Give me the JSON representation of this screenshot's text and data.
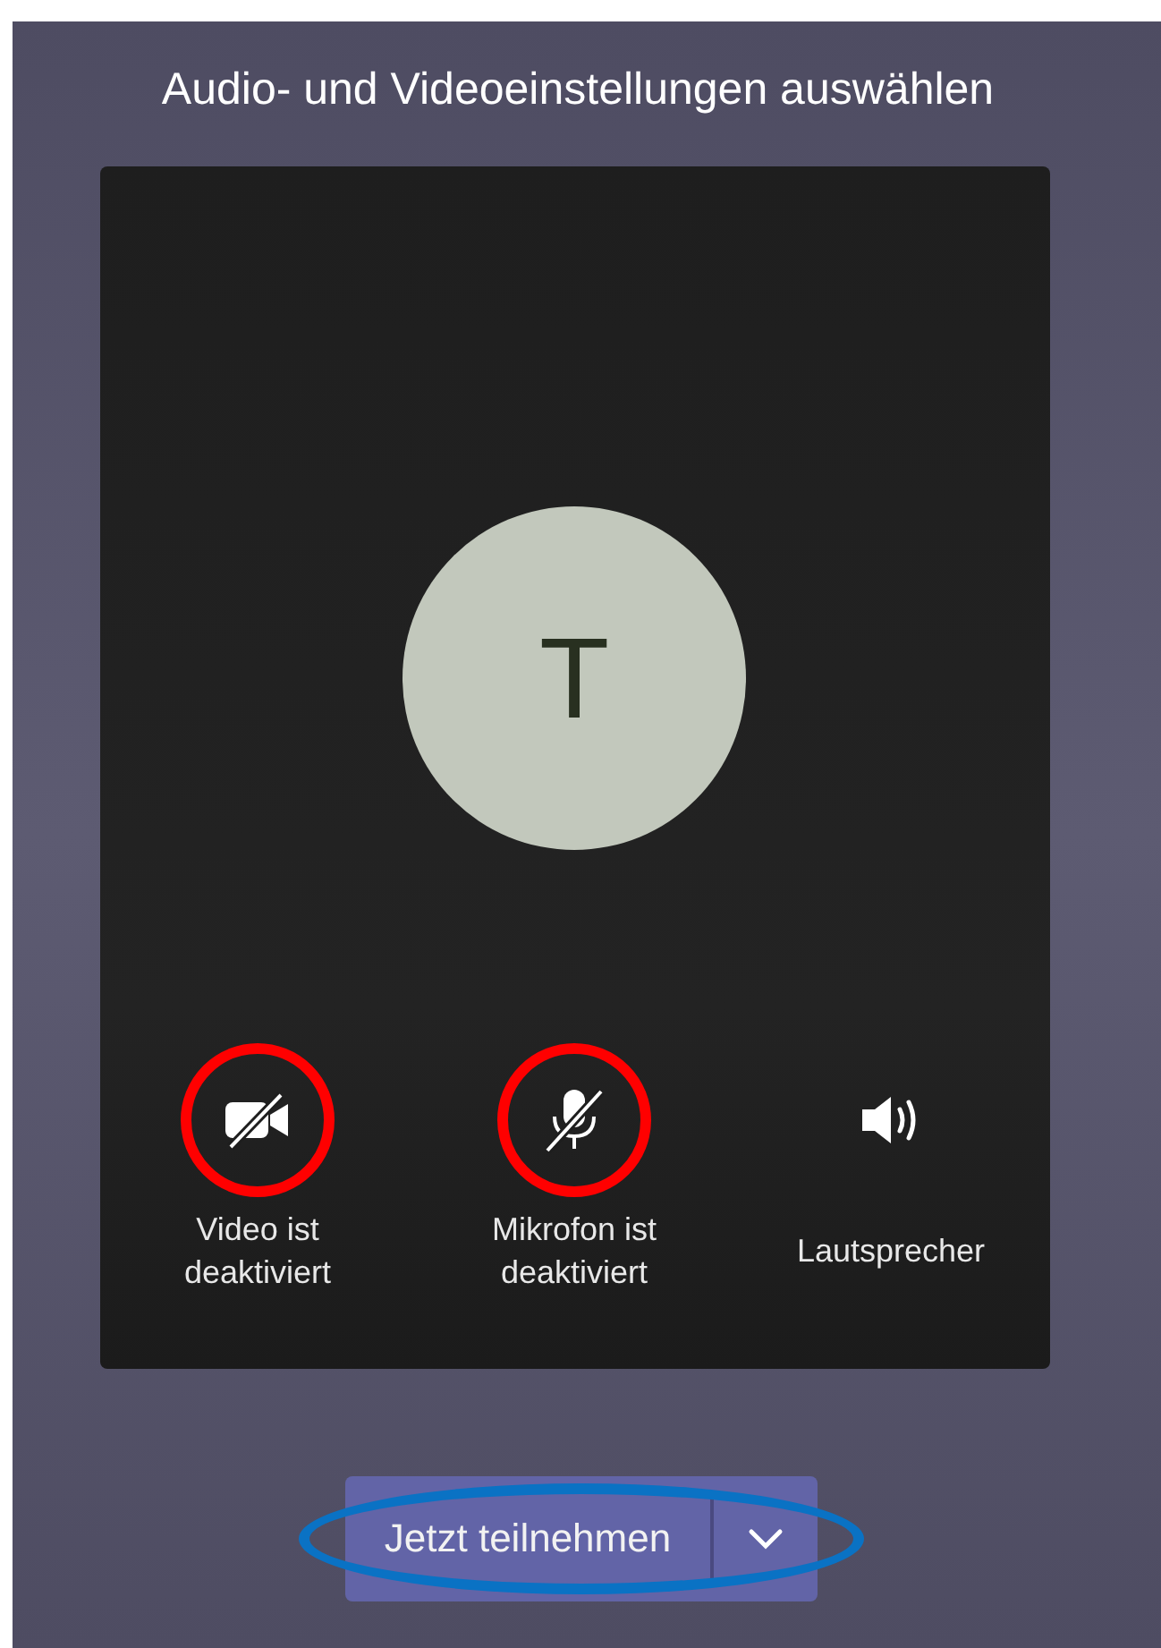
{
  "title": "Audio- und Videoeinstellungen auswählen",
  "avatar": {
    "initial": "T"
  },
  "controls": [
    {
      "kind": "video",
      "label": "Video ist deaktiviert",
      "off": true,
      "highlighted": true
    },
    {
      "kind": "mic",
      "label": "Mikrofon ist deaktiviert",
      "off": true,
      "highlighted": true
    },
    {
      "kind": "speaker",
      "label": "Lautsprecher",
      "off": false,
      "highlighted": false
    }
  ],
  "join_button": {
    "label": "Jetzt teilnehmen",
    "highlighted": true
  }
}
